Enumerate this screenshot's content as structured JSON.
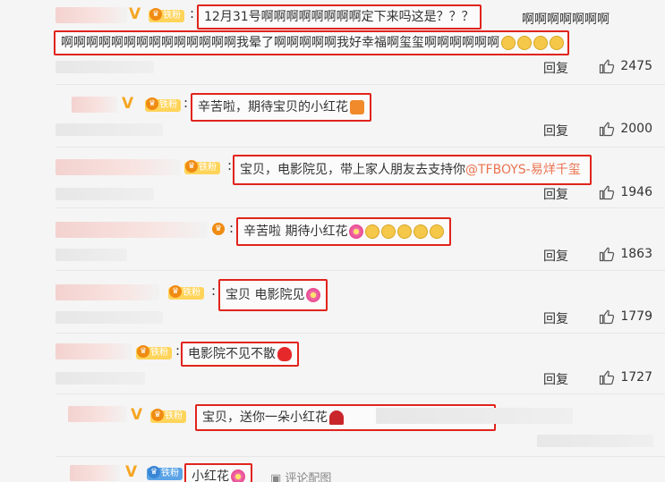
{
  "comments": [
    {
      "quote": "12月31号啊啊啊啊啊啊啊啊定下来吗这是？？？",
      "overflow_text": "啊啊啊啊啊啊啊",
      "quote2": "啊啊啊啊啊啊啊啊啊啊啊啊啊啊我晕了啊啊啊啊啊我好幸福啊玺玺啊啊啊啊啊啊",
      "reply": "回复",
      "likes": "2475",
      "badge": "铁粉"
    },
    {
      "quote": "辛苦啦，期待宝贝的小红花",
      "reply": "回复",
      "likes": "2000",
      "badge": "铁粉"
    },
    {
      "quote": "宝贝，电影院见，带上家人朋友去支持你",
      "mention": "@TFBOYS-易烊千玺",
      "reply": "回复",
      "likes": "1946",
      "badge": "铁粉"
    },
    {
      "quote": "辛苦啦 期待小红花",
      "reply": "回复",
      "likes": "1863"
    },
    {
      "quote": "宝贝 电影院见",
      "reply": "回复",
      "likes": "1779",
      "badge": "铁粉"
    },
    {
      "quote": "电影院不见不散",
      "reply": "回复",
      "likes": "1727",
      "badge": "铁粉"
    },
    {
      "quote": "宝贝，送你一朵小红花",
      "badge": "铁粉"
    },
    {
      "quote": "小红花",
      "img_link": "评论配图",
      "badge": "铁粉"
    }
  ],
  "icons": {
    "thumb": "thumb-up-icon",
    "verified": "verified-v-icon",
    "crown": "fan-crown-icon",
    "image": "image-icon"
  },
  "colors": {
    "highlight_border": "#e0241c",
    "mention": "#eb7350",
    "fan_badge": "#ffd45a",
    "verified": "#f5a623"
  }
}
